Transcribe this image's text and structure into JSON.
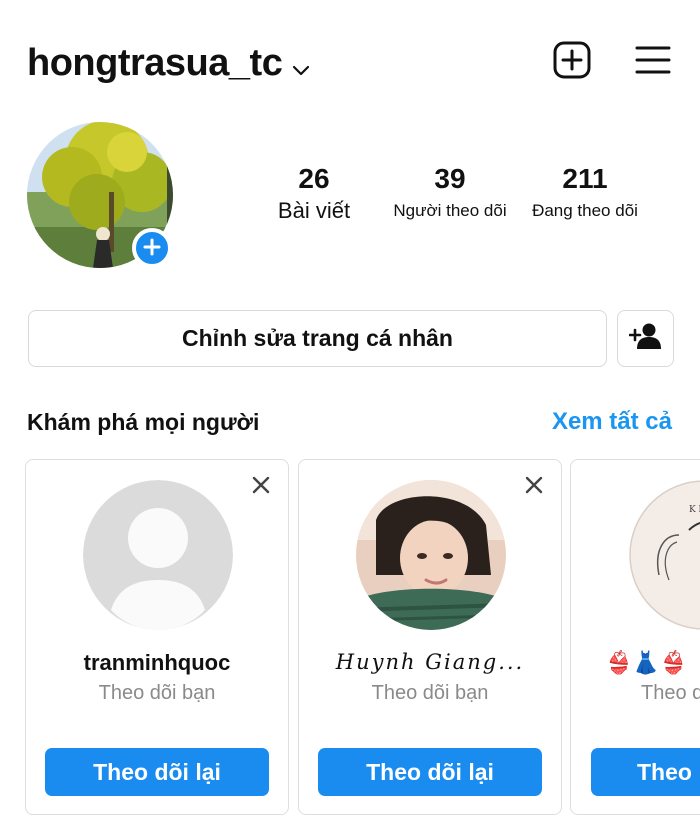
{
  "header": {
    "username": "hongtrasua_tc",
    "icons": [
      "chevron-down-icon",
      "new-post-icon",
      "hamburger-menu-icon"
    ]
  },
  "profile": {
    "stats": {
      "posts": {
        "count": "26",
        "label": "Bài viết"
      },
      "followers": {
        "count": "39",
        "label": "Người theo dõi"
      },
      "following": {
        "count": "211",
        "label": "Đang theo dõi"
      }
    },
    "add_story_icon": "plus-icon"
  },
  "actions": {
    "edit_profile_label": "Chỉnh sửa trang cá nhân",
    "discover_people_icon": "add-person-icon"
  },
  "discover": {
    "title": "Khám phá mọi người",
    "see_all": "Xem tất cả",
    "cards": [
      {
        "name": "tranminhquoc",
        "subtitle": "Theo dõi bạn",
        "button": "Theo dõi lại"
      },
      {
        "name": "Huynh Giang...",
        "subtitle": "Theo dõi bạn",
        "button": "Theo dõi lại"
      },
      {
        "name": "👙👗👙",
        "subtitle": "Theo d",
        "button": "Theo"
      }
    ]
  },
  "colors": {
    "accent_blue": "#1a8cf0",
    "link_blue": "#1a96f0",
    "muted_text": "#8a8a8a",
    "border": "#dedede"
  }
}
